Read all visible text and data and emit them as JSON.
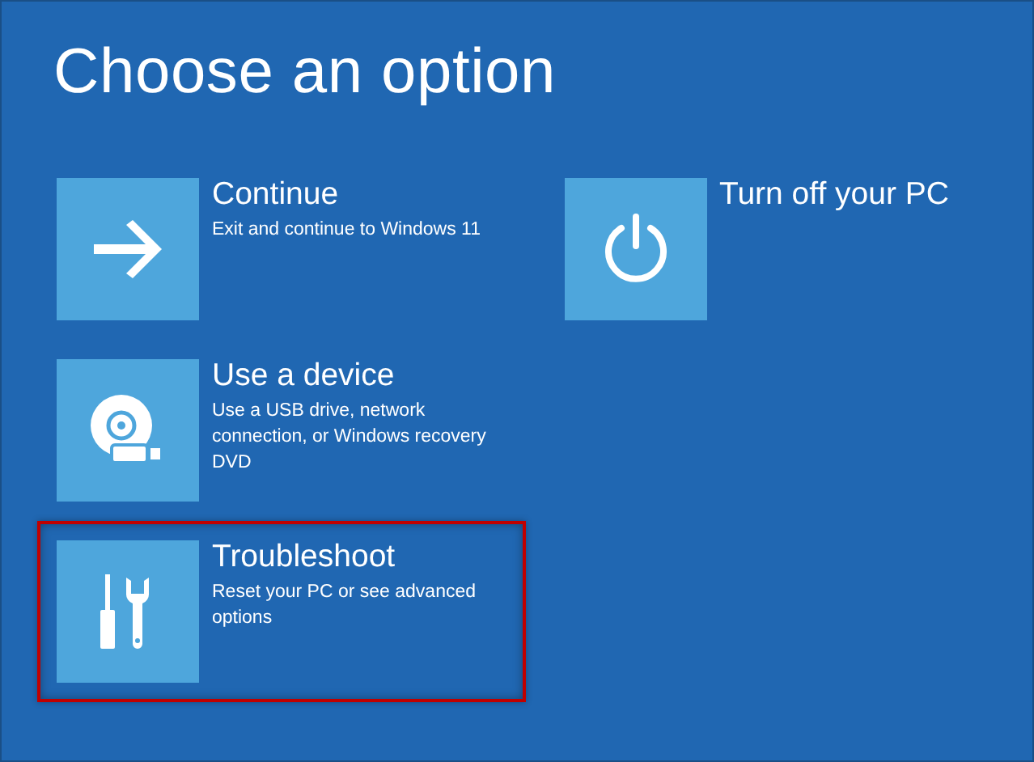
{
  "title": "Choose an option",
  "columns": [
    [
      {
        "title": "Continue",
        "description": "Exit and continue to Windows 11",
        "highlighted": false
      },
      {
        "title": "Use a device",
        "description": "Use a USB drive, network connection, or Windows recovery DVD",
        "highlighted": false
      },
      {
        "title": "Troubleshoot",
        "description": "Reset your PC or see advanced options",
        "highlighted": true
      }
    ],
    [
      {
        "title": "Turn off your PC",
        "highlighted": false
      }
    ]
  ]
}
